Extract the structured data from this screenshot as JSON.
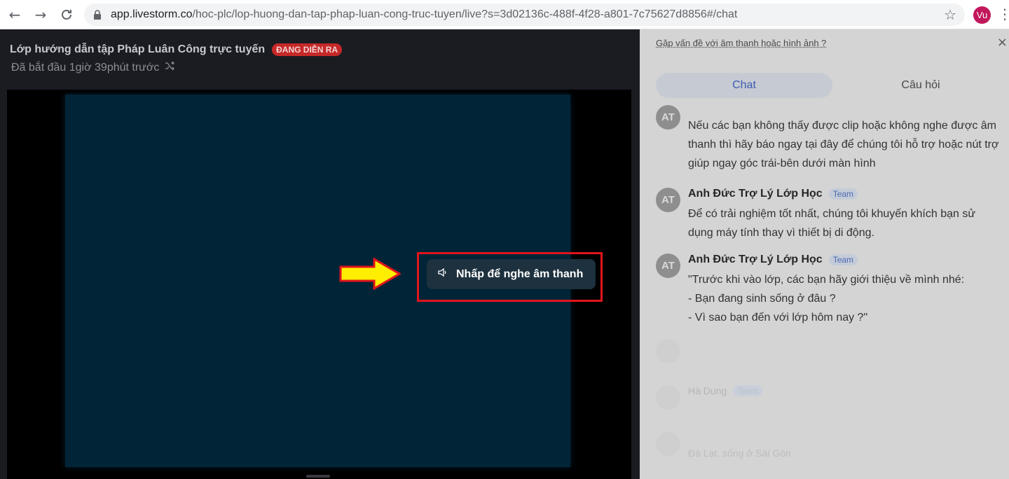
{
  "browser": {
    "url_host": "app.livestorm.co",
    "url_path": "/hoc-plc/lop-huong-dan-tap-phap-luan-cong-truc-tuyen/live?s=3d02136c-488f-4f28-a801-7c75627d8856#/chat",
    "profile_initials": "Vu",
    "icons": {
      "back": "arrow-left-icon",
      "forward": "arrow-right-icon",
      "reload": "reload-icon",
      "lock": "lock-icon",
      "bookmark": "star-icon",
      "menu": "kebab-menu-icon"
    }
  },
  "event": {
    "title": "Lớp hướng dẫn tập Pháp Luân Công trực tuyến",
    "live_badge": "ĐANG DIỄN RA",
    "started": "Đã bắt đầu 1giờ 39phút trước"
  },
  "player": {
    "sound_button_label": "Nhấp để nghe âm thanh"
  },
  "sidebar": {
    "issue_link": "Gặp vấn đề với âm thanh hoặc hình ảnh ?",
    "tabs": [
      {
        "label": "Chat",
        "active": true
      },
      {
        "label": "Câu hỏi",
        "active": false
      }
    ],
    "messages": [
      {
        "avatar": "AT",
        "name": "",
        "badge": "",
        "text": "Nếu các bạn không thấy được clip hoặc không nghe được âm thanh thì hãy báo ngay tại đây để chúng tôi hỗ trợ hoặc nút trợ giúp ngay góc trái-bên dưới màn hình"
      },
      {
        "avatar": "AT",
        "name": "Anh Đức Trợ Lý Lớp Học",
        "badge": "Team",
        "text": "Để có trải nghiệm tốt nhất, chúng tôi khuyến khích bạn sử dụng máy tính thay vì thiết bị di động."
      },
      {
        "avatar": "AT",
        "name": "Anh Đức Trợ Lý Lớp Học",
        "badge": "Team",
        "text": "\"Trước khi vào lớp, các bạn hãy giới thiệu về mình nhé:\n- Bạn đang sinh sống ở đâu ?\n- Vì sao bạn đến với lớp hôm nay ?\""
      },
      {
        "avatar": "",
        "name": "",
        "badge": "",
        "text": ""
      },
      {
        "avatar": "",
        "name": "Hà Dung",
        "badge": "Team",
        "text": ""
      },
      {
        "avatar": "",
        "name": "",
        "badge": "",
        "text": "Đà Lạt, sống ở Sài Gòn"
      }
    ]
  },
  "colors": {
    "accent_red": "#e0151c",
    "arrow_yellow": "#ffee00",
    "video_bg": "#012437"
  }
}
